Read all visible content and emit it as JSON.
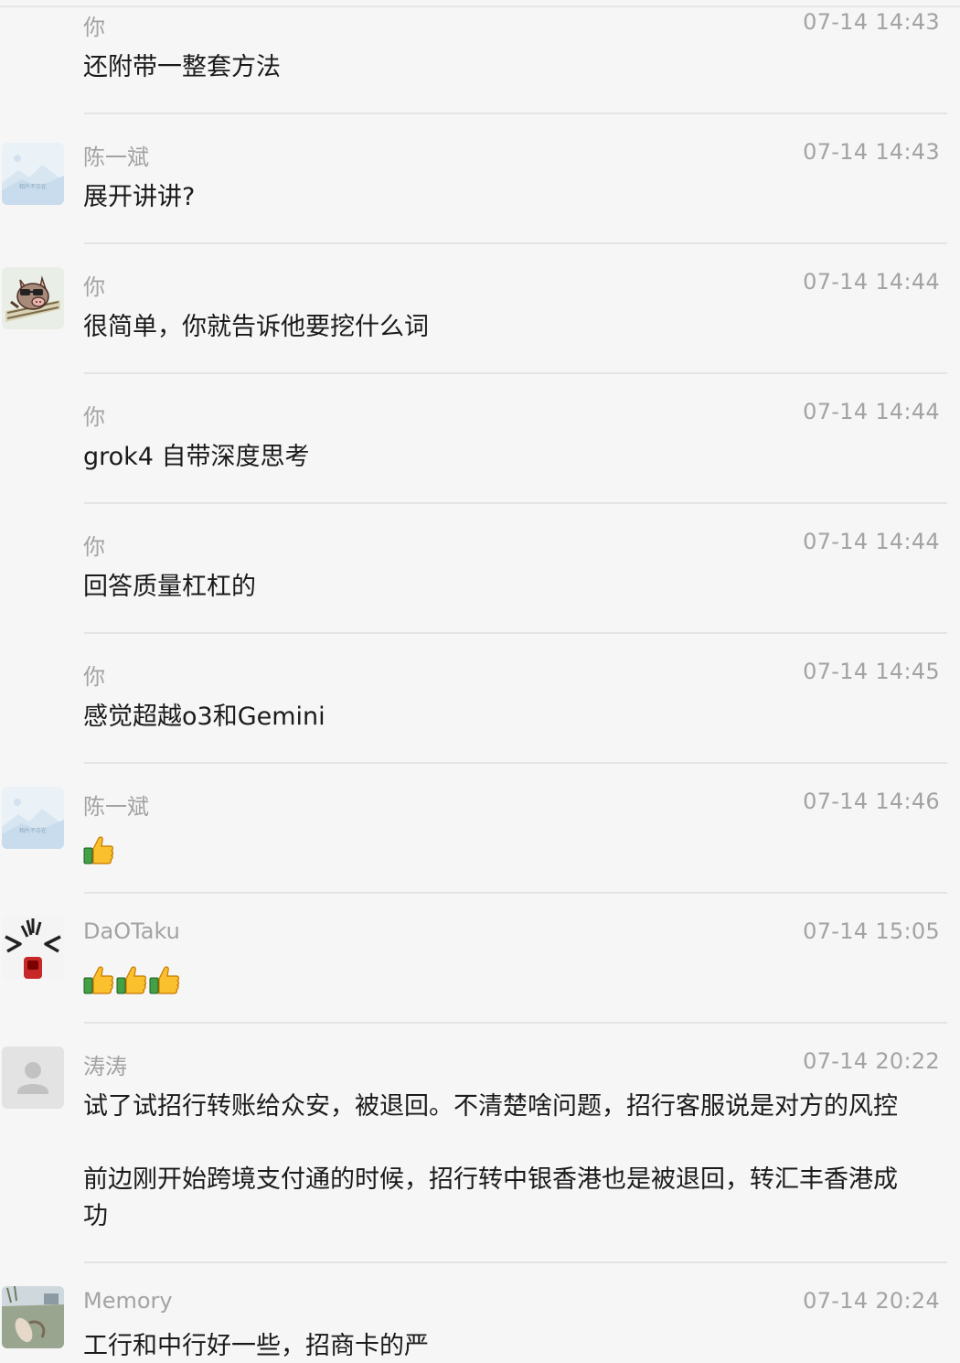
{
  "messages": [
    {
      "sender": "你",
      "time": "07-14 14:43",
      "text": "还附带一整套方法"
    },
    {
      "sender": "陈一斌",
      "time": "07-14 14:43",
      "text": "展开讲讲?",
      "avatar_caption": "相片不存在"
    },
    {
      "sender": "你",
      "time": "07-14 14:44",
      "text": "很简单，你就告诉他要挖什么词"
    },
    {
      "sender": "你",
      "time": "07-14 14:44",
      "text": "grok4 自带深度思考"
    },
    {
      "sender": "你",
      "time": "07-14 14:44",
      "text": "回答质量杠杠的"
    },
    {
      "sender": "你",
      "time": "07-14 14:45",
      "text": "感觉超越o3和Gemini"
    },
    {
      "sender": "陈一斌",
      "time": "07-14 14:46",
      "emoji": "thumbs-up",
      "emoji_count": 1,
      "avatar_caption": "相片不存在"
    },
    {
      "sender": "DaOTaku",
      "time": "07-14 15:05",
      "emoji": "thumbs-up",
      "emoji_count": 3
    },
    {
      "sender": "涛涛",
      "time": "07-14 20:22",
      "paragraphs": [
        [
          "试了试招行转账给众安，被退回。不清楚啥问题，招行客服说是对方的风控"
        ],
        [
          "前边刚开始跨境支付通的时候，招行转中银香港也是被退回，转汇丰香港成",
          "功"
        ]
      ]
    },
    {
      "sender": "Memory",
      "time": "07-14 20:24",
      "text": "工行和中行好一些，招商卡的严"
    }
  ],
  "colors": {
    "background": "#f6f6f6",
    "meta_text": "#a3a3a3",
    "body_text": "#1a1a1a",
    "divider": "#e4e4e4"
  },
  "icons": {
    "placeholder_avatar": "landscape-placeholder-icon",
    "pig_avatar": "pig-sunglasses-avatar",
    "shock_avatar": "shocked-face-avatar",
    "default_avatar": "person-silhouette-icon",
    "photo_avatar": "photo-avatar",
    "emoji": "thumbs-up-icon"
  }
}
